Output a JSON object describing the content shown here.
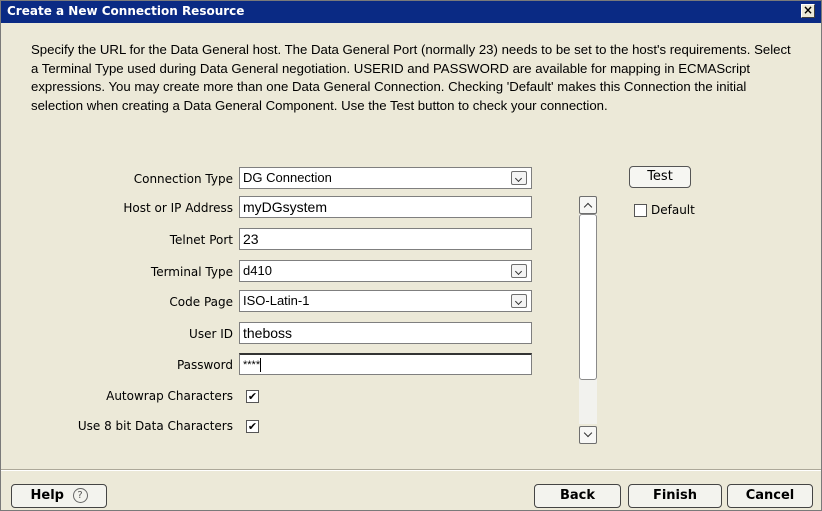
{
  "window": {
    "title": "Create a New Connection Resource",
    "close_label": "×"
  },
  "description": "Specify the URL for the Data General host.  The Data General Port (normally 23) needs to be set to the host's requirements.  Select a Terminal Type used during Data General negotiation. USERID and PASSWORD are available for mapping in ECMAScript expressions.  You may create more than one Data General Connection. Checking 'Default' makes this Connection the initial selection when creating a Data General Component. Use the Test button to check your connection.",
  "form": {
    "connection_type": {
      "label": "Connection Type",
      "value": "DG Connection"
    },
    "host": {
      "label": "Host or IP Address",
      "value": "myDGsystem"
    },
    "telnet_port": {
      "label": "Telnet Port",
      "value": "23"
    },
    "terminal_type": {
      "label": "Terminal Type",
      "value": "d410"
    },
    "code_page": {
      "label": "Code Page",
      "value": "ISO-Latin-1"
    },
    "user_id": {
      "label": "User ID",
      "value": "theboss"
    },
    "password": {
      "label": "Password",
      "value": "****"
    },
    "autowrap": {
      "label": "Autowrap Characters",
      "checked": true,
      "mark": "✔"
    },
    "eight_bit": {
      "label": "Use 8 bit Data Characters",
      "checked": true,
      "mark": "✔"
    }
  },
  "side": {
    "test_label": "Test",
    "default_label": "Default",
    "default_checked": false
  },
  "footer": {
    "help_label": "Help",
    "help_icon": "?",
    "back_label": "Back",
    "finish_label": "Finish",
    "cancel_label": "Cancel"
  }
}
